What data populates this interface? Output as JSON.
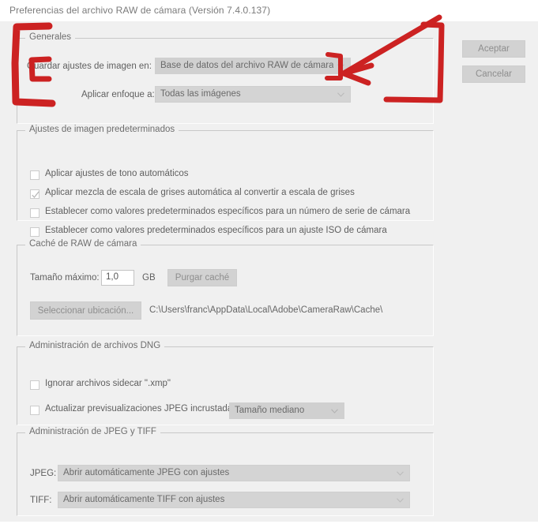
{
  "window": {
    "title": "Preferencias del archivo RAW de cámara  (Versión 7.4.0.137)",
    "app_title": "Preferencias del archivo RAW de cámara",
    "version": "Versión 7.4.0.137"
  },
  "buttons": {
    "ok": "Aceptar",
    "cancel": "Cancelar"
  },
  "groups": {
    "general": {
      "legend": "Generales",
      "save_settings_label": "Guardar ajustes de imagen en:",
      "save_settings_value": "Base de datos del archivo RAW de cámara",
      "apply_sharpening_label": "Aplicar enfoque a:",
      "apply_sharpening_value": "Todas las imágenes"
    },
    "default_image_settings": {
      "legend": "Ajustes de imagen predeterminados",
      "checkboxes": [
        {
          "label": "Aplicar ajustes de tono automáticos",
          "checked": false
        },
        {
          "label": "Aplicar mezcla de escala de grises automática al convertir a escala de grises",
          "checked": true
        },
        {
          "label": "Establecer como valores predeterminados específicos para un número de serie de cámara",
          "checked": false
        },
        {
          "label": "Establecer como valores predeterminados específicos para un ajuste ISO de cámara",
          "checked": false
        }
      ]
    },
    "camera_raw_cache": {
      "legend": "Caché de RAW de cámara",
      "max_size_label": "Tamaño máximo:",
      "max_size_value": "1,0",
      "unit": "GB",
      "purge_button": "Purgar caché",
      "select_location_button": "Seleccionar ubicación...",
      "path": "C:\\Users\\franc\\AppData\\Local\\Adobe\\CameraRaw\\Cache\\"
    },
    "dng_handling": {
      "legend": "Administración de archivos DNG",
      "ignore_sidecar": {
        "label": "Ignorar archivos sidecar \".xmp\"",
        "checked": false
      },
      "update_previews": {
        "label": "Actualizar previsualizaciones JPEG incrustadas:",
        "checked": false
      },
      "preview_size_value": "Tamaño mediano"
    },
    "jpeg_tiff_handling": {
      "legend": "Administración de JPEG y TIFF",
      "jpeg_label": "JPEG:",
      "jpeg_value": "Abrir automáticamente JPEG con ajustes",
      "tiff_label": "TIFF:",
      "tiff_value": "Abrir automáticamente TIFF con ajustes"
    }
  },
  "annotations": {
    "color": "#cc2222",
    "shapes": [
      "left-bracket-general-section",
      "inner-bracket-save-settings-label",
      "arrow-pointing-to-save-settings-dropdown",
      "small-bracket-dropdown-right-edge",
      "large-right-bracket-general-section"
    ]
  },
  "icons": {
    "chevron_down": "chevron-down-icon",
    "checkmark": "checkmark-icon"
  }
}
